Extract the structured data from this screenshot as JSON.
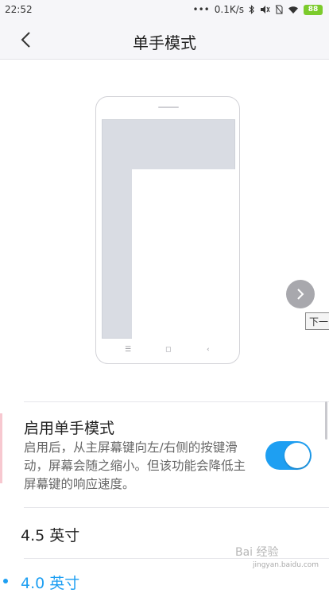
{
  "status_bar": {
    "time": "22:52",
    "network_speed": "0.1K/s",
    "battery": "88",
    "icons": [
      "dots-icon",
      "bluetooth-icon",
      "mute-icon",
      "no-sim-icon",
      "wifi-icon",
      "battery-icon"
    ]
  },
  "header": {
    "title": "单手模式",
    "back_icon": "chevron-left-icon"
  },
  "illustration": {
    "next_tip": "下一"
  },
  "setting": {
    "title": "启用单手模式",
    "description": "启用后，从主屏幕键向左/右侧的按键滑动，屏幕会随之缩小。但该功能会降低主屏幕键的响应速度。",
    "enabled": true
  },
  "sizes": [
    {
      "label": "4.5 英寸",
      "selected": false
    },
    {
      "label": "4.0 英寸",
      "selected": true
    }
  ],
  "watermark": {
    "text": "Bai 经验",
    "sub": "jingyan.baidu.com"
  },
  "colors": {
    "accent": "#1e9ff2",
    "toggle_on": "#1e9ff2",
    "header_bg": "#f6f6f9"
  }
}
